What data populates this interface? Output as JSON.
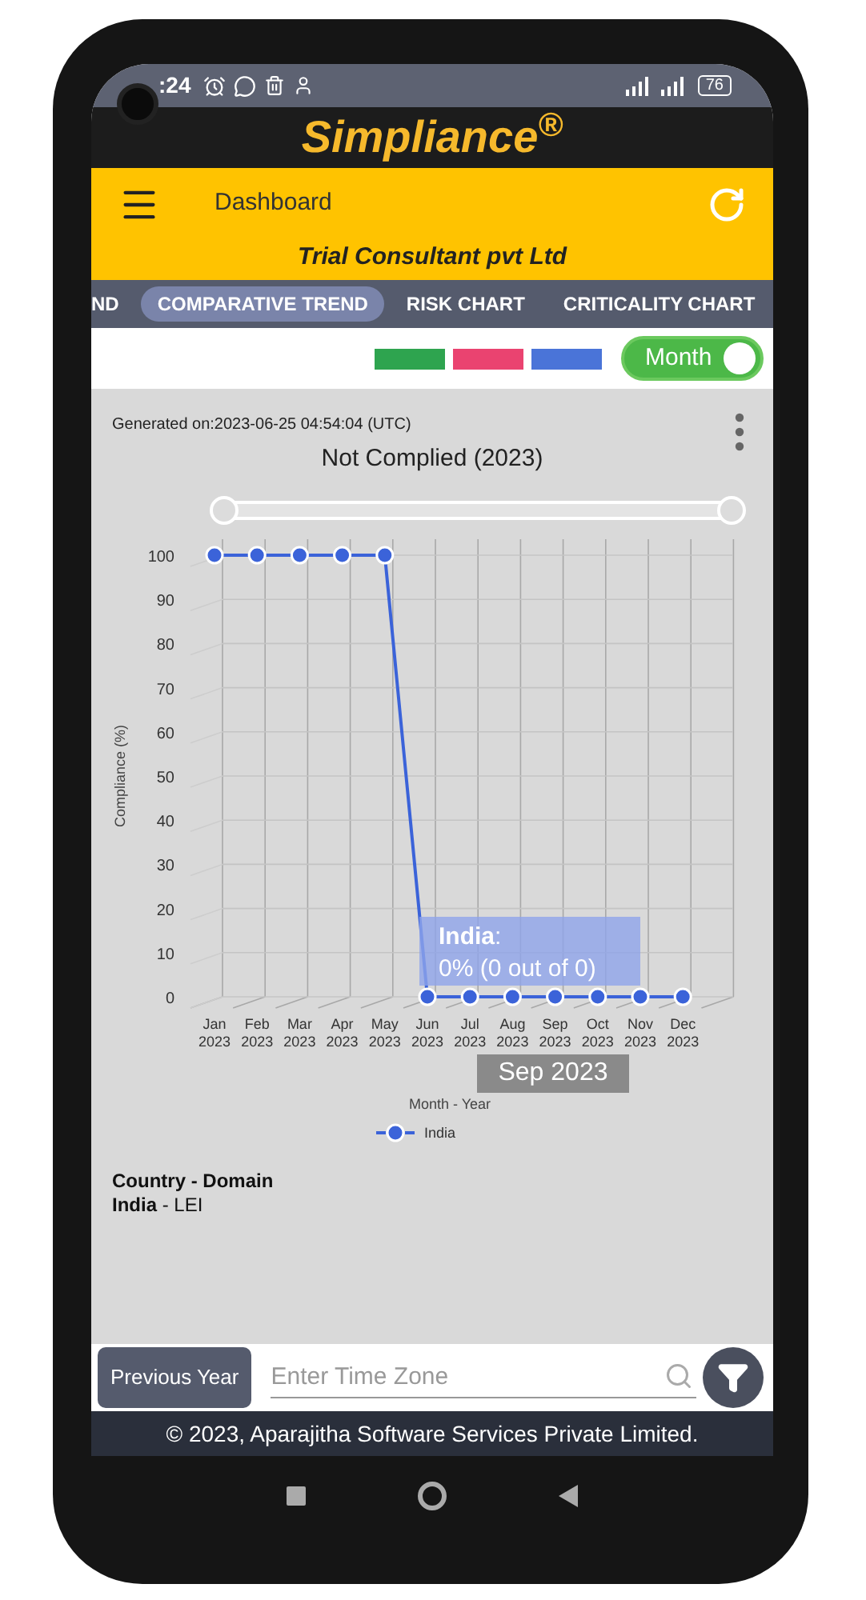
{
  "status_bar": {
    "time": ":24",
    "battery": "76"
  },
  "app_logo": "Simpliance$^{®}$",
  "header": {
    "title": "Dashboard",
    "company": "Trial Consultant pvt Ltd"
  },
  "tabs": [
    {
      "label": "ND",
      "selected": false
    },
    {
      "label": "COMPARATIVE TREND",
      "selected": true
    },
    {
      "label": "RISK CHART",
      "selected": false
    },
    {
      "label": "CRITICALITY CHART",
      "selected": false
    }
  ],
  "legend_swatches": [
    {
      "color": "#2ea44f"
    },
    {
      "color": "#ea4370"
    },
    {
      "color": "#4a74d8"
    }
  ],
  "period_toggle": {
    "label": "Month",
    "on": true
  },
  "report": {
    "generated": "Generated on:2023-06-25 04:54:04 (UTC)",
    "chart_data": {
      "type": "line",
      "title": "Not Complied (2023)",
      "xlabel": "Month - Year",
      "ylabel": "Compliance (%)",
      "categories": [
        "Jan 2023",
        "Feb 2023",
        "Mar 2023",
        "Apr 2023",
        "May 2023",
        "Jun 2023",
        "Jul 2023",
        "Aug 2023",
        "Sep 2023",
        "Oct 2023",
        "Nov 2023",
        "Dec 2023"
      ],
      "series": [
        {
          "name": "India",
          "color": "#3b63d9",
          "marker": "circle",
          "values": [
            100,
            100,
            100,
            100,
            100,
            0,
            0,
            0,
            0,
            0,
            0,
            0
          ]
        }
      ],
      "ylim": [
        0,
        100
      ],
      "grid": true,
      "yticks": [
        0,
        10,
        20,
        30,
        40,
        50,
        60,
        70,
        80,
        90,
        100
      ]
    },
    "tooltip": {
      "series": "**India**:",
      "value": "0% (0 out of 0)",
      "category": "Sep 2023"
    },
    "details_heading": "Country - Domain",
    "details": "**India** - LEI"
  },
  "bottom_bar": {
    "button": "Previous Year",
    "time_zone": {
      "placeholder": "Enter Time Zone"
    }
  },
  "footer": "© 2023, Aparajitha Software Services Private Limited."
}
